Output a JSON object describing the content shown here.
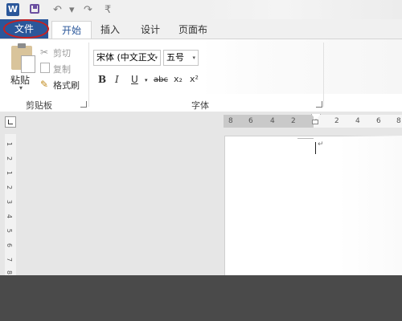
{
  "quick_access": {
    "app_logo": "W",
    "icons": [
      "word-logo",
      "save-icon",
      "undo-icon",
      "undo-dropdown",
      "redo-icon",
      "customize-quick-access"
    ],
    "undo_glyph": "↶",
    "undo_drop_glyph": "▾",
    "redo_glyph": "↷",
    "customize_glyph": "₹"
  },
  "tabs": {
    "file": "文件",
    "home": "开始",
    "insert": "插入",
    "design": "设计",
    "layout": "页面布"
  },
  "clipboard": {
    "paste": "粘贴",
    "cut": "剪切",
    "copy": "复制",
    "format_painter": "格式刷",
    "group_label": "剪贴板",
    "paste_dropdown": "▾"
  },
  "font": {
    "name": "宋体 (中文正文",
    "size": "五号",
    "dropdown": "▾",
    "bold": "B",
    "italic": "I",
    "underline": "U",
    "underline_dropdown": "▾",
    "strikethrough": "abc",
    "subscript": "x₂",
    "superscript": "x²",
    "group_label": "字体"
  },
  "ruler": {
    "h_ticks": [
      "8",
      "6",
      "4",
      "2",
      "2",
      "4",
      "6",
      "8"
    ],
    "v_ticks": [
      "1",
      "2",
      "1",
      "2",
      "3",
      "4",
      "5",
      "6",
      "7",
      "8"
    ]
  },
  "document": {
    "paragraph_mark": "↵"
  },
  "colors": {
    "accent": "#2b579a",
    "highlight_circle": "#c8201f"
  }
}
